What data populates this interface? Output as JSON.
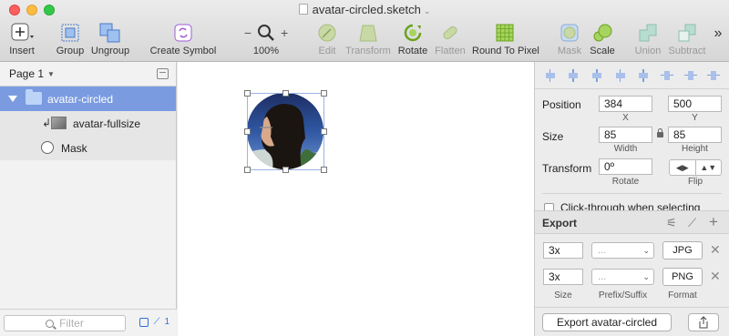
{
  "window": {
    "title": "avatar-circled.sketch"
  },
  "toolbar": {
    "insert": "Insert",
    "group": "Group",
    "ungroup": "Ungroup",
    "create_symbol": "Create Symbol",
    "zoom": "100%",
    "zoom_minus": "−",
    "zoom_plus": "+",
    "edit": "Edit",
    "transform": "Transform",
    "rotate": "Rotate",
    "flatten": "Flatten",
    "round_to_pixel": "Round To Pixel",
    "mask": "Mask",
    "scale": "Scale",
    "union": "Union",
    "subtract": "Subtract",
    "overflow": "»"
  },
  "layers": {
    "page": "Page 1",
    "items": [
      {
        "label": "avatar-circled"
      },
      {
        "label": "avatar-fullsize"
      },
      {
        "label": "Mask"
      }
    ],
    "filter_placeholder": "Filter",
    "footer_count": "1"
  },
  "inspector": {
    "position_label": "Position",
    "x": "384",
    "y": "500",
    "x_sub": "X",
    "y_sub": "Y",
    "size_label": "Size",
    "width": "85",
    "height": "85",
    "width_sub": "Width",
    "height_sub": "Height",
    "transform_label": "Transform",
    "rotate": "0º",
    "rotate_sub": "Rotate",
    "flip_sub": "Flip",
    "clickthrough": "Click-through when selecting"
  },
  "export": {
    "title": "Export",
    "rows": [
      {
        "size": "3x",
        "prefix": "...",
        "format": "JPG"
      },
      {
        "size": "3x",
        "prefix": "...",
        "format": "PNG"
      }
    ],
    "size_sub": "Size",
    "prefix_sub": "Prefix/Suffix",
    "format_sub": "Format",
    "button": "Export avatar-circled"
  },
  "colors": {
    "selection": "#7a9be0",
    "accent": "#2f6ee0"
  }
}
